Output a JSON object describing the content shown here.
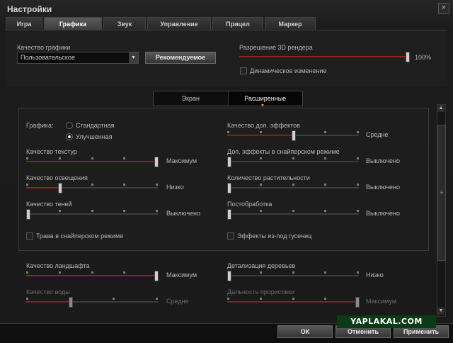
{
  "window": {
    "title": "Настройки",
    "close": "×"
  },
  "tabs": [
    "Игра",
    "Графика",
    "Звук",
    "Управление",
    "Прицел",
    "Маркер"
  ],
  "active_tab": "Графика",
  "graphics_quality": {
    "label": "Качество графики",
    "value": "Пользовательское",
    "recommended_button": "Рекомендуемое"
  },
  "render_resolution": {
    "label": "Разрешение 3D рендера",
    "value": "100%",
    "level": 1.0,
    "dynamic_label": "Динамическое изменение",
    "dynamic_checked": false
  },
  "subtabs": [
    "Экран",
    "Расширенные"
  ],
  "active_subtab": "Расширенные",
  "graphics_mode": {
    "label": "Графика:",
    "options": [
      "Стандартная",
      "Улучшенная"
    ],
    "selected": "Улучшенная"
  },
  "left_settings": [
    {
      "label": "Качество текстур",
      "value": "Максимум",
      "level": 1.0,
      "steps": 5,
      "disabled": false
    },
    {
      "label": "Качество освещения",
      "value": "Низко",
      "level": 0.25,
      "steps": 5,
      "disabled": false
    },
    {
      "label": "Качество теней",
      "value": "Выключено",
      "level": 0.0,
      "steps": 5,
      "disabled": false
    }
  ],
  "right_settings": [
    {
      "label": "Качество доп. эффектов",
      "value": "Средне",
      "level": 0.5,
      "steps": 5,
      "disabled": false
    },
    {
      "label": "Доп. эффекты в снайперском режиме",
      "value": "Выключено",
      "level": 0.0,
      "steps": 5,
      "disabled": false
    },
    {
      "label": "Количество растительности",
      "value": "Выключено",
      "level": 0.0,
      "steps": 5,
      "disabled": false
    },
    {
      "label": "Постобработка",
      "value": "Выключено",
      "level": 0.0,
      "steps": 5,
      "disabled": false
    }
  ],
  "checkboxes": [
    {
      "label": "Трава в снайперском режиме",
      "checked": false
    },
    {
      "label": "Эффекты из-под гусениц",
      "checked": false
    }
  ],
  "lower_left": [
    {
      "label": "Качество ландшафта",
      "value": "Максимум",
      "level": 1.0,
      "steps": 5,
      "disabled": false
    },
    {
      "label": "Качество воды",
      "value": "Средне",
      "level": 0.333,
      "steps": 4,
      "disabled": true
    }
  ],
  "lower_right": [
    {
      "label": "Детализация деревьев",
      "value": "Низко",
      "level": 0.0,
      "steps": 5,
      "disabled": false
    },
    {
      "label": "Дальность прорисовки",
      "value": "Максимум",
      "level": 1.0,
      "steps": 5,
      "disabled": true
    }
  ],
  "buttons": {
    "ok": "ОК",
    "cancel": "Отменить",
    "apply": "Применить"
  },
  "watermark": "YAPLAKAL.COM",
  "colors": {
    "accent": "#b12a1e",
    "glow": "#ff7a1a",
    "watermark_bg": "#0a3b14"
  }
}
